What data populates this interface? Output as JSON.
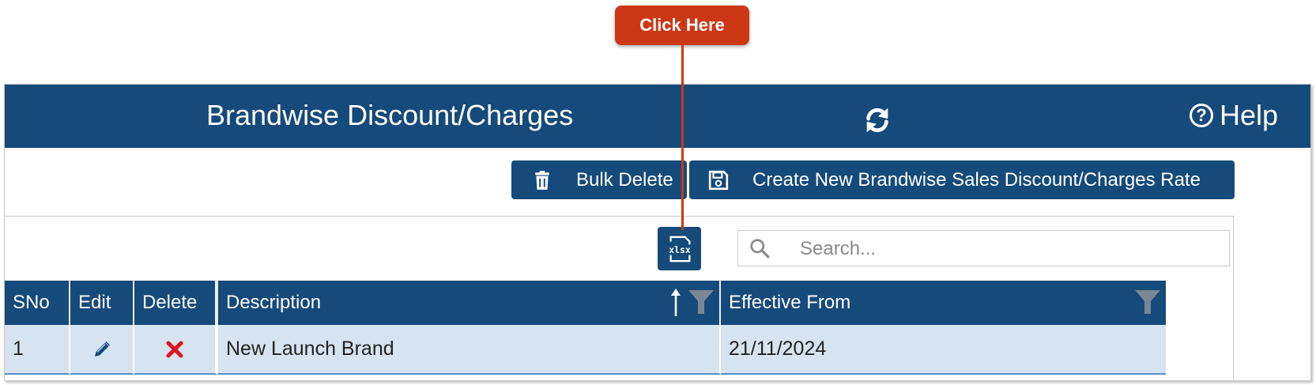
{
  "callout": {
    "label": "Click Here"
  },
  "header": {
    "title": "Brandwise Discount/Charges",
    "help_label": "Help"
  },
  "toolbar": {
    "bulk_delete_label": "Bulk Delete",
    "create_label": "Create New Brandwise Sales Discount/Charges Rate"
  },
  "export": {
    "icon": "xlsx-export-icon"
  },
  "search": {
    "placeholder": "Search..."
  },
  "grid": {
    "columns": [
      "SNo",
      "Edit",
      "Delete",
      "Description",
      "Effective From"
    ],
    "rows": [
      {
        "sno": "1",
        "description": "New Launch Brand",
        "effective_from": "21/11/2024"
      }
    ]
  },
  "colors": {
    "header_bg": "#154a7a",
    "callout_bg": "#cc3816",
    "row_bg": "#d6e3f0",
    "delete_icon": "#e0141e"
  }
}
